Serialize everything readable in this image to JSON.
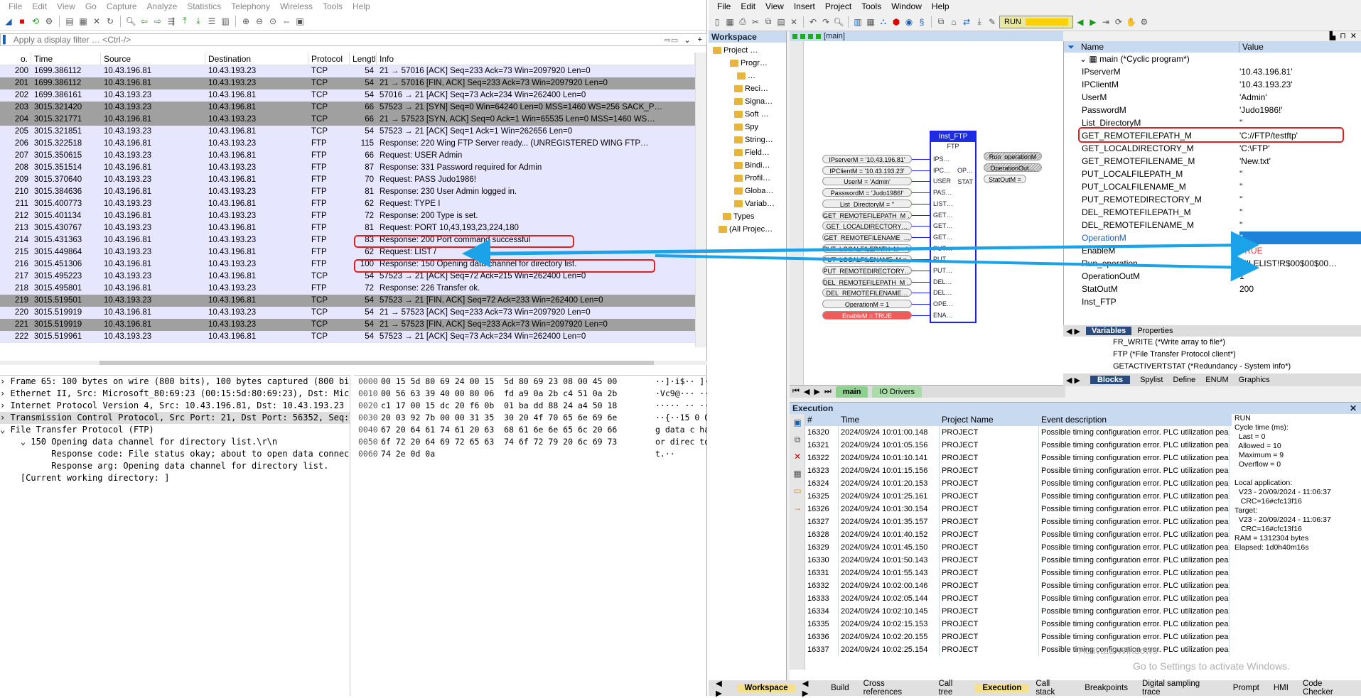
{
  "wireshark": {
    "menu": [
      "File",
      "Edit",
      "View",
      "Go",
      "Capture",
      "Analyze",
      "Statistics",
      "Telephony",
      "Wireless",
      "Tools",
      "Help"
    ],
    "filter_placeholder": "Apply a display filter … <Ctrl-/>",
    "columns": [
      "o.",
      "Time",
      "Source",
      "Destination",
      "Protocol",
      "Lengtl",
      "Info"
    ],
    "packets": [
      {
        "no": "200",
        "time": "1699.386112",
        "src": "10.43.196.81",
        "dst": "10.43.193.23",
        "proto": "TCP",
        "len": "54",
        "info": "21 → 57016 [ACK] Seq=233 Ack=73 Win=2097920 Len=0",
        "style": "tcp"
      },
      {
        "no": "201",
        "time": "1699.386112",
        "src": "10.43.196.81",
        "dst": "10.43.193.23",
        "proto": "TCP",
        "len": "54",
        "info": "21 → 57016 [FIN, ACK] Seq=233 Ack=73 Win=2097920 Len=0",
        "style": "dark"
      },
      {
        "no": "202",
        "time": "1699.386161",
        "src": "10.43.193.23",
        "dst": "10.43.196.81",
        "proto": "TCP",
        "len": "54",
        "info": "57016 → 21 [ACK] Seq=73 Ack=234 Win=262400 Len=0",
        "style": "tcp"
      },
      {
        "no": "203",
        "time": "3015.321420",
        "src": "10.43.193.23",
        "dst": "10.43.196.81",
        "proto": "TCP",
        "len": "66",
        "info": "57523 → 21 [SYN] Seq=0 Win=64240 Len=0 MSS=1460 WS=256 SACK_P…",
        "style": "dark"
      },
      {
        "no": "204",
        "time": "3015.321771",
        "src": "10.43.196.81",
        "dst": "10.43.193.23",
        "proto": "TCP",
        "len": "66",
        "info": "21 → 57523 [SYN, ACK] Seq=0 Ack=1 Win=65535 Len=0 MSS=1460 WS…",
        "style": "dark"
      },
      {
        "no": "205",
        "time": "3015.321851",
        "src": "10.43.193.23",
        "dst": "10.43.196.81",
        "proto": "TCP",
        "len": "54",
        "info": "57523 → 21 [ACK] Seq=1 Ack=1 Win=262656 Len=0",
        "style": "tcp"
      },
      {
        "no": "206",
        "time": "3015.322518",
        "src": "10.43.196.81",
        "dst": "10.43.193.23",
        "proto": "FTP",
        "len": "115",
        "info": "Response: 220 Wing FTP Server ready... (UNREGISTERED WING FTP…",
        "style": "ftp"
      },
      {
        "no": "207",
        "time": "3015.350615",
        "src": "10.43.193.23",
        "dst": "10.43.196.81",
        "proto": "FTP",
        "len": "66",
        "info": "Request: USER Admin",
        "style": "ftp"
      },
      {
        "no": "208",
        "time": "3015.351514",
        "src": "10.43.196.81",
        "dst": "10.43.193.23",
        "proto": "FTP",
        "len": "87",
        "info": "Response: 331 Password required for Admin",
        "style": "ftp"
      },
      {
        "no": "209",
        "time": "3015.370640",
        "src": "10.43.193.23",
        "dst": "10.43.196.81",
        "proto": "FTP",
        "len": "70",
        "info": "Request: PASS Judo1986!",
        "style": "ftp"
      },
      {
        "no": "210",
        "time": "3015.384636",
        "src": "10.43.196.81",
        "dst": "10.43.193.23",
        "proto": "FTP",
        "len": "81",
        "info": "Response: 230 User Admin logged in.",
        "style": "ftp"
      },
      {
        "no": "211",
        "time": "3015.400773",
        "src": "10.43.193.23",
        "dst": "10.43.196.81",
        "proto": "FTP",
        "len": "62",
        "info": "Request: TYPE I",
        "style": "ftp"
      },
      {
        "no": "212",
        "time": "3015.401134",
        "src": "10.43.196.81",
        "dst": "10.43.193.23",
        "proto": "FTP",
        "len": "72",
        "info": "Response: 200 Type is set.",
        "style": "ftp"
      },
      {
        "no": "213",
        "time": "3015.430767",
        "src": "10.43.193.23",
        "dst": "10.43.196.81",
        "proto": "FTP",
        "len": "81",
        "info": "Request: PORT 10,43,193,23,224,180",
        "style": "ftp"
      },
      {
        "no": "214",
        "time": "3015.431363",
        "src": "10.43.196.81",
        "dst": "10.43.193.23",
        "proto": "FTP",
        "len": "83",
        "info": "Response: 200 Port command successful",
        "style": "ftp"
      },
      {
        "no": "215",
        "time": "3015.449864",
        "src": "10.43.193.23",
        "dst": "10.43.196.81",
        "proto": "FTP",
        "len": "62",
        "info": "Request: LIST /",
        "style": "ftp"
      },
      {
        "no": "216",
        "time": "3015.451306",
        "src": "10.43.196.81",
        "dst": "10.43.193.23",
        "proto": "FTP",
        "len": "100",
        "info": "Response: 150 Opening data channel for directory list.",
        "style": "ftp"
      },
      {
        "no": "217",
        "time": "3015.495223",
        "src": "10.43.193.23",
        "dst": "10.43.196.81",
        "proto": "TCP",
        "len": "54",
        "info": "57523 → 21 [ACK] Seq=72 Ack=215 Win=262400 Len=0",
        "style": "tcp"
      },
      {
        "no": "218",
        "time": "3015.495801",
        "src": "10.43.196.81",
        "dst": "10.43.193.23",
        "proto": "FTP",
        "len": "72",
        "info": "Response: 226 Transfer ok.",
        "style": "ftp"
      },
      {
        "no": "219",
        "time": "3015.519501",
        "src": "10.43.193.23",
        "dst": "10.43.196.81",
        "proto": "TCP",
        "len": "54",
        "info": "57523 → 21 [FIN, ACK] Seq=72 Ack=233 Win=262400 Len=0",
        "style": "dark"
      },
      {
        "no": "220",
        "time": "3015.519919",
        "src": "10.43.196.81",
        "dst": "10.43.193.23",
        "proto": "TCP",
        "len": "54",
        "info": "21 → 57523 [ACK] Seq=233 Ack=73 Win=2097920 Len=0",
        "style": "tcp"
      },
      {
        "no": "221",
        "time": "3015.519919",
        "src": "10.43.196.81",
        "dst": "10.43.193.23",
        "proto": "TCP",
        "len": "54",
        "info": "21 → 57523 [FIN, ACK] Seq=233 Ack=73 Win=2097920 Len=0",
        "style": "dark"
      },
      {
        "no": "222",
        "time": "3015.519961",
        "src": "10.43.193.23",
        "dst": "10.43.196.81",
        "proto": "TCP",
        "len": "54",
        "info": "57523 → 21 [ACK] Seq=73 Ack=234 Win=262400 Len=0",
        "style": "tcp"
      }
    ],
    "details": [
      "› Frame 65: 100 bytes on wire (800 bits), 100 bytes captured (800 bit",
      "› Ethernet II, Src: Microsoft_80:69:23 (00:15:5d:80:69:23), Dst: Micro",
      "› Internet Protocol Version 4, Src: 10.43.196.81, Dst: 10.43.193.23",
      "› Transmission Control Protocol, Src Port: 21, Dst Port: 56352, Seq: 1",
      "⌄ File Transfer Protocol (FTP)",
      "    ⌄ 150 Opening data channel for directory list.\\r\\n",
      "          Response code: File status okay; about to open data connection",
      "          Response arg: Opening data channel for directory list.",
      "    [Current working directory: ]"
    ],
    "bytes": [
      {
        "off": "0000",
        "hex": "00 15 5d 80 69 24 00 15  5d 80 69 23 08 00 45 00",
        "asc": "··]·i$·· ]·i#"
      },
      {
        "off": "0010",
        "hex": "00 56 63 39 40 00 80 06  fd a9 0a 2b c4 51 0a 2b",
        "asc": "·Vc9@···  ···+"
      },
      {
        "off": "0020",
        "hex": "c1 17 00 15 dc 20 f6 0b  01 ba dd 88 24 a4 50 18",
        "asc": "····· ··  ····"
      },
      {
        "off": "0030",
        "hex": "20 03 92 7b 00 00 31 35  30 20 4f 70 65 6e 69 6e",
        "asc": " ··{··15 0 Op"
      },
      {
        "off": "0040",
        "hex": "67 20 64 61 74 61 20 63  68 61 6e 6e 65 6c 20 66",
        "asc": "g data c hann"
      },
      {
        "off": "0050",
        "hex": "6f 72 20 64 69 72 65 63  74 6f 72 79 20 6c 69 73",
        "asc": "or direc tory"
      },
      {
        "off": "0060",
        "hex": "74 2e 0d 0a",
        "asc": "t.··"
      }
    ]
  },
  "ide": {
    "menu": [
      "File",
      "Edit",
      "View",
      "Insert",
      "Project",
      "Tools",
      "Window",
      "Help"
    ],
    "run_status": "RUN",
    "workspace_title": "Workspace",
    "tree": [
      "Project …",
      "Progr…",
      "…",
      "Reci…",
      "Signa…",
      "Soft …",
      "Spy",
      "String…",
      "Field…",
      "Bindi…",
      "Profil…",
      "Globa…",
      "Variab…",
      "Types",
      "(All Projec…"
    ],
    "fbd_title": "[main]",
    "fb_name": "Inst_FTP",
    "fb_type": "FTP",
    "inputs": [
      "IPserverM = '10.43.196.81'",
      "IPClientM = '10.43.193.23'",
      "UserM = 'Admin'",
      "PasswordM = 'Judo1986!'",
      "List_DirectoryM = ''",
      "GET_REMOTEFILEPATH_M …",
      "GET_LOCALDIRECTORY…",
      "GET_REMOTEFILENAME_…",
      "PUT_LOCALFILEPATH_M = '…",
      "PUT_LOCALFILENAME_M = …",
      "PUT_REMOTEDIRECTORY…",
      "DEL_REMOTEFILEPATH_M …",
      "DEL_REMOTEFILENAME…",
      "OperationM = 1",
      "EnableM = TRUE"
    ],
    "fb_pins": [
      "IPS…",
      "IPC…",
      "USER",
      "PAS…",
      "LIST…",
      "GET…",
      "GET…",
      "GET…",
      "PUT…",
      "PUT…",
      "PUT…",
      "DEL…",
      "DEL…",
      "OPE…",
      "ENA…"
    ],
    "fb_outs": [
      "OP…",
      "STAT"
    ],
    "outputs": [
      "Run_operationM",
      "OperationOut…",
      "StatOutM ="
    ],
    "fbd_tabs": [
      "main",
      "IO Drivers"
    ],
    "var_header": [
      "Name",
      "Value"
    ],
    "var_root": "main (*Cyclic program*)",
    "vars": [
      {
        "name": "IPserverM",
        "value": "'10.43.196.81'"
      },
      {
        "name": "IPClientM",
        "value": "'10.43.193.23'"
      },
      {
        "name": "UserM",
        "value": "'Admin'"
      },
      {
        "name": "PasswordM",
        "value": "'Judo1986!'"
      },
      {
        "name": "List_DirectoryM",
        "value": "''"
      },
      {
        "name": "GET_REMOTEFILEPATH_M",
        "value": "'C://FTP/testftp'"
      },
      {
        "name": "GET_LOCALDIRECTORY_M",
        "value": "'C:\\FTP'"
      },
      {
        "name": "GET_REMOTEFILENAME_M",
        "value": "'New.txt'"
      },
      {
        "name": "PUT_LOCALFILEPATH_M",
        "value": "''"
      },
      {
        "name": "PUT_LOCALFILENAME_M",
        "value": "''"
      },
      {
        "name": "PUT_REMOTEDIRECTORY_M",
        "value": "''"
      },
      {
        "name": "DEL_REMOTEFILEPATH_M",
        "value": "''"
      },
      {
        "name": "DEL_REMOTEFILENAME_M",
        "value": "''"
      },
      {
        "name": "OperationM",
        "value": "1"
      },
      {
        "name": "EnableM",
        "value": "TRUE"
      },
      {
        "name": "Run_operation…",
        "value": "'FILELIST!R$00$00$00…"
      },
      {
        "name": "OperationOutM",
        "value": "1"
      },
      {
        "name": "StatOutM",
        "value": "200"
      },
      {
        "name": "Inst_FTP",
        "value": ""
      }
    ],
    "var_tabs": [
      "Variables",
      "Properties"
    ],
    "blocks": [
      "FR_WRITE (*Write array to file*)",
      "FTP (*File Transfer Protocol client*)",
      "GETACTIVERTSTAT (*Redundancy - System info*)"
    ],
    "blk_tabs": [
      "Blocks",
      "Spylist",
      "Define",
      "ENUM",
      "Graphics"
    ],
    "exec_title": "Execution",
    "exec_header": [
      "#",
      "Time",
      "Project Name",
      "Event description"
    ],
    "exec_rows": [
      [
        "16320",
        "2024/09/24 10:01:00.148",
        "PROJECT",
        "Possible timing configuration error. PLC utilization peak"
      ],
      [
        "16321",
        "2024/09/24 10:01:05.156",
        "PROJECT",
        "Possible timing configuration error. PLC utilization peak"
      ],
      [
        "16322",
        "2024/09/24 10:01:10.141",
        "PROJECT",
        "Possible timing configuration error. PLC utilization peak"
      ],
      [
        "16323",
        "2024/09/24 10:01:15.156",
        "PROJECT",
        "Possible timing configuration error. PLC utilization peak"
      ],
      [
        "16324",
        "2024/09/24 10:01:20.153",
        "PROJECT",
        "Possible timing configuration error. PLC utilization peak"
      ],
      [
        "16325",
        "2024/09/24 10:01:25.161",
        "PROJECT",
        "Possible timing configuration error. PLC utilization peak"
      ],
      [
        "16326",
        "2024/09/24 10:01:30.154",
        "PROJECT",
        "Possible timing configuration error. PLC utilization peak"
      ],
      [
        "16327",
        "2024/09/24 10:01:35.157",
        "PROJECT",
        "Possible timing configuration error. PLC utilization peak"
      ],
      [
        "16328",
        "2024/09/24 10:01:40.152",
        "PROJECT",
        "Possible timing configuration error. PLC utilization peak"
      ],
      [
        "16329",
        "2024/09/24 10:01:45.150",
        "PROJECT",
        "Possible timing configuration error. PLC utilization peak"
      ],
      [
        "16330",
        "2024/09/24 10:01:50.143",
        "PROJECT",
        "Possible timing configuration error. PLC utilization peak"
      ],
      [
        "16331",
        "2024/09/24 10:01:55.143",
        "PROJECT",
        "Possible timing configuration error. PLC utilization peak"
      ],
      [
        "16332",
        "2024/09/24 10:02:00.146",
        "PROJECT",
        "Possible timing configuration error. PLC utilization peak"
      ],
      [
        "16333",
        "2024/09/24 10:02:05.144",
        "PROJECT",
        "Possible timing configuration error. PLC utilization peak"
      ],
      [
        "16334",
        "2024/09/24 10:02:10.145",
        "PROJECT",
        "Possible timing configuration error. PLC utilization peak"
      ],
      [
        "16335",
        "2024/09/24 10:02:15.153",
        "PROJECT",
        "Possible timing configuration error. PLC utilization peak"
      ],
      [
        "16336",
        "2024/09/24 10:02:20.155",
        "PROJECT",
        "Possible timing configuration error. PLC utilization peak"
      ],
      [
        "16337",
        "2024/09/24 10:02:25.154",
        "PROJECT",
        "Possible timing configuration error. PLC utilization peak"
      ]
    ],
    "status_lines": [
      "RUN",
      "Cycle time (ms):",
      "  Last = 0",
      "  Allowed = 10",
      "  Maximum = 9",
      "  Overflow = 0",
      "",
      "Local application:",
      "  V23 - 20/09/2024 - 11:06:37",
      "   CRC=16#cfc13f16",
      "Target:",
      "  V23 - 20/09/2024 - 11:06:37",
      "   CRC=16#cfc13f16",
      "RAM = 1312304 bytes",
      "Elapsed: 1d0h40m16s"
    ],
    "bottom_tabs": [
      "Workspace",
      "Build",
      "Cross references",
      "Call tree",
      "Execution",
      "Call stack",
      "Breakpoints",
      "Digital sampling trace",
      "Prompt",
      "HMI",
      "Code Checker"
    ],
    "watermark1": "Activate Windows",
    "watermark2": "Go to Settings to activate Windows."
  },
  "colors": {
    "highlight": "#e02020",
    "arrow": "#1aa3e8",
    "fb_blue": "#1e2edd"
  }
}
